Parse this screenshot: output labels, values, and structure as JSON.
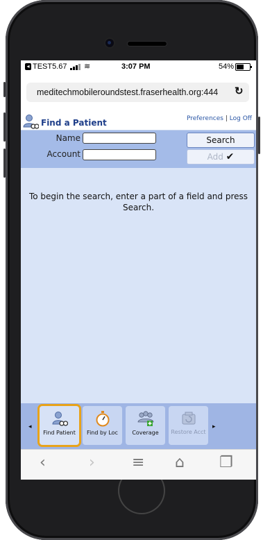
{
  "status": {
    "back_glyph": "◂",
    "carrier": "TEST5.67",
    "wifi_glyph": "≋",
    "time": "3:07 PM",
    "battery_pct_label": "54%",
    "battery_level": 0.54
  },
  "browser": {
    "url": "meditechmobileroundstest.fraserhealth.org:444",
    "reload_icon": "↻"
  },
  "header": {
    "title": "Find a Patient",
    "preferences": "Preferences",
    "separator": "|",
    "logoff": "Log Off"
  },
  "form": {
    "name_label": "Name",
    "name_value": "",
    "account_label": "Account",
    "account_value": "",
    "search_label": "Search",
    "add_label": "Add",
    "add_check": "✔"
  },
  "main": {
    "message": "To begin the search, enter a part of a field and press Search."
  },
  "toolbar": {
    "left_arrow": "◂",
    "right_arrow": "▸",
    "items": [
      {
        "label": "Find Patient",
        "icon": "find-patient-icon",
        "selected": true
      },
      {
        "label": "Find by Loc",
        "icon": "stopwatch-icon"
      },
      {
        "label": "Coverage",
        "icon": "coverage-icon"
      },
      {
        "label": "Restore Acct",
        "icon": "restore-account-icon",
        "disabled": true
      }
    ]
  },
  "safari": {
    "back": "‹",
    "forward": "›",
    "menu": "≡",
    "home": "⌂",
    "tabs": "❐"
  },
  "colors": {
    "header_text": "#1f3f8a",
    "form_band": "#a4bbe8",
    "content_bg": "#d9e4f7",
    "toolbar_bg": "#9fb5e4",
    "selection_highlight": "#e8a31a"
  }
}
